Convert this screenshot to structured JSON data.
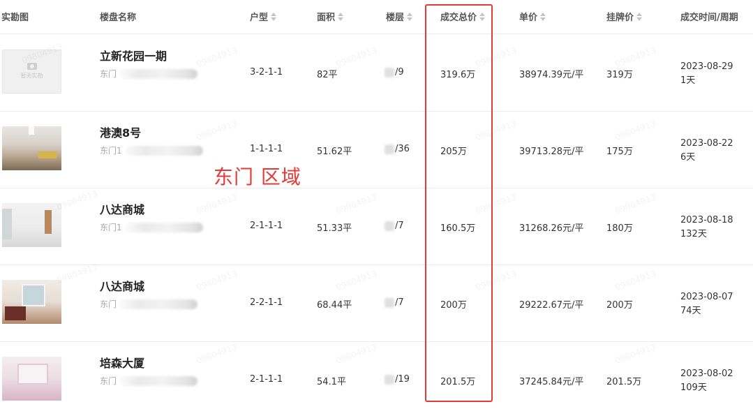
{
  "headers": {
    "photo": "实勘图",
    "name": "楼盘名称",
    "layout": "户型",
    "area": "面积",
    "floor": "楼层",
    "total_price": "成交总价",
    "unit_price": "单价",
    "list_price": "挂牌价",
    "deal_time": "成交时间/周期"
  },
  "placeholder_text": "暂无实勘",
  "annotation": "东门 区域",
  "watermark": "09804913",
  "colors": {
    "highlight": "#e53935"
  },
  "rows": [
    {
      "name": "立新花园一期",
      "district": "东门",
      "layout": "3-2-1-1",
      "area": "82平",
      "floor": "/9",
      "total_price": "319.6万",
      "unit_price": "38974.39元/平",
      "list_price": "319万",
      "date": "2023-08-29",
      "cycle": "1天",
      "photo": "placeholder"
    },
    {
      "name": "港澳8号",
      "district": "东门1",
      "layout": "1-1-1-1",
      "area": "51.62平",
      "floor": "/36",
      "total_price": "205万",
      "unit_price": "39713.28元/平",
      "list_price": "175万",
      "date": "2023-08-22",
      "cycle": "6天",
      "photo": "living-room"
    },
    {
      "name": "八达商城",
      "district": "东门1",
      "layout": "2-1-1-1",
      "area": "51.33平",
      "floor": "/7",
      "total_price": "160.5万",
      "unit_price": "31268.26元/平",
      "list_price": "180万",
      "date": "2023-08-18",
      "cycle": "132天",
      "photo": "empty-room"
    },
    {
      "name": "八达商城",
      "district": "东门",
      "layout": "2-2-1-1",
      "area": "68.44平",
      "floor": "/7",
      "total_price": "200万",
      "unit_price": "29222.67元/平",
      "list_price": "200万",
      "date": "2023-08-07",
      "cycle": "74天",
      "photo": "bedroom"
    },
    {
      "name": "培森大厦",
      "district": "东门",
      "layout": "2-1-1-1",
      "area": "54.1平",
      "floor": "/19",
      "total_price": "201.5万",
      "unit_price": "37245.84元/平",
      "list_price": "201.5万",
      "date": "2023-08-02",
      "cycle": "109天",
      "photo": "pink-room"
    }
  ]
}
